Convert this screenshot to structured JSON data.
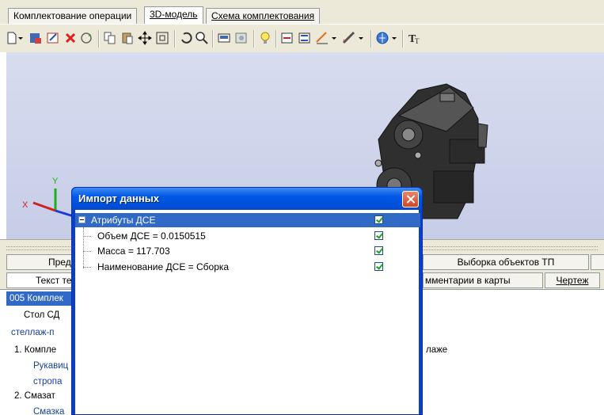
{
  "top_tabs": [
    {
      "label": "Комплектование операции"
    },
    {
      "label": "3D-модель"
    },
    {
      "label": "Схема комплектования"
    }
  ],
  "toolbar_icons": [
    "new-doc-icon",
    "dropdown-icon",
    "save-icon",
    "edit-icon",
    "delete-icon",
    "refresh-icon",
    "copy-icon",
    "paste-icon",
    "move-icon",
    "fit-icon",
    "rotate-icon",
    "zoom-icon",
    "view-icon",
    "image-icon",
    "bulb-icon",
    "insert-icon",
    "measure-icon",
    "grid-icon",
    "ruler-icon",
    "globe-icon",
    "font-icon"
  ],
  "axes": {
    "x": "X",
    "y": "Y"
  },
  "lower_tabs_row1": [
    {
      "label": "Пред"
    },
    {
      "label": "Выборка объектов ТП"
    }
  ],
  "lower_tabs_row2": [
    {
      "label": "Текст те"
    },
    {
      "label": "мментарии в карты"
    },
    {
      "label": "Чертеж"
    }
  ],
  "doc_rows": [
    "005 Комплек",
    "Стол СД",
    "стеллаж-п",
    "1. Компле",
    "Рукавиц",
    "стропа",
    "2. Смазат",
    "Смазка"
  ],
  "doc_right_text": "лаже",
  "dialog": {
    "title": "Импорт данных",
    "root": "Атрибуты ДСЕ",
    "items": [
      "Объем ДСЕ = 0.0150515",
      "Масса = 117.703",
      "Наименование ДСЕ = Сборка"
    ]
  }
}
